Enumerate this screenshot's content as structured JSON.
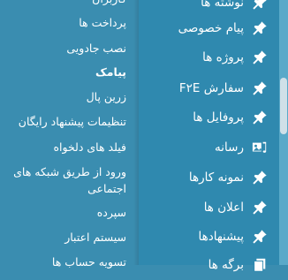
{
  "main_menu": [
    {
      "label": "نوشته ها",
      "icon": "pin-icon"
    },
    {
      "label": "پیام خصوصی",
      "icon": "pin-icon"
    },
    {
      "label": "پروژه ها",
      "icon": "pin-icon"
    },
    {
      "label": "سفارش F۲E",
      "icon": "pin-icon"
    },
    {
      "label": "پروفایل ها",
      "icon": "pin-icon"
    },
    {
      "label": "رسانه",
      "icon": "media-icon"
    },
    {
      "label": "نمونه کارها",
      "icon": "pin-icon"
    },
    {
      "label": "اعلان ها",
      "icon": "pin-icon"
    },
    {
      "label": "پیشنهادها",
      "icon": "pin-icon"
    },
    {
      "label": "برگه ها",
      "icon": "pages-icon"
    }
  ],
  "sub_menu": [
    {
      "label": "کاربران",
      "current": false
    },
    {
      "label": "پرداخت ها",
      "current": false
    },
    {
      "label": "نصب جادویی",
      "current": false
    },
    {
      "label": "پیامک",
      "current": true
    },
    {
      "label": "زرین پال",
      "current": false
    },
    {
      "label": "تنظیمات پیشنهاد رایگان",
      "current": false
    },
    {
      "label": "فیلد های دلخواه",
      "current": false
    },
    {
      "label": "ورود از طریق شبکه های اجتماعی",
      "current": false
    },
    {
      "label": "سپرده",
      "current": false
    },
    {
      "label": "سیستم اعتبار",
      "current": false
    },
    {
      "label": "تسویه حساب ها",
      "current": false
    }
  ],
  "colors": {
    "menu_bg": "#2f89af",
    "submenu_bg": "#3a8db0",
    "text": "#ffffff"
  }
}
